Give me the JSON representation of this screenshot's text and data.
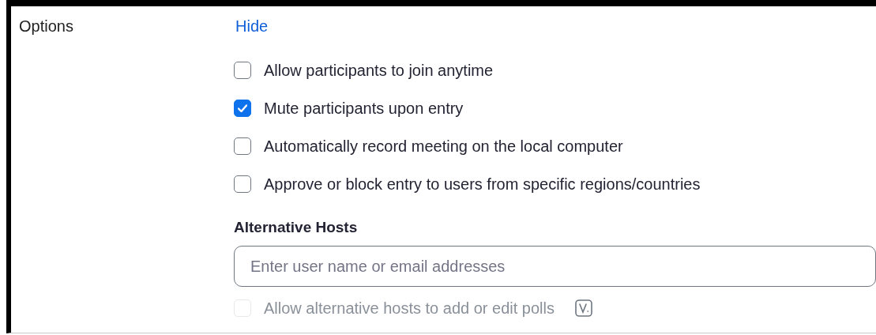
{
  "section_label": "Options",
  "hide_link": "Hide",
  "options": [
    {
      "label": "Allow participants to join anytime",
      "checked": false,
      "disabled": false
    },
    {
      "label": "Mute participants upon entry",
      "checked": true,
      "disabled": false
    },
    {
      "label": "Automatically record meeting on the local computer",
      "checked": false,
      "disabled": false
    },
    {
      "label": "Approve or block entry to users from specific regions/countries",
      "checked": false,
      "disabled": false
    }
  ],
  "alternative_hosts": {
    "heading": "Alternative Hosts",
    "placeholder": "Enter user name or email addresses",
    "options": [
      {
        "label": "Allow alternative hosts to add or edit polls",
        "checked": false,
        "disabled": true
      }
    ]
  }
}
